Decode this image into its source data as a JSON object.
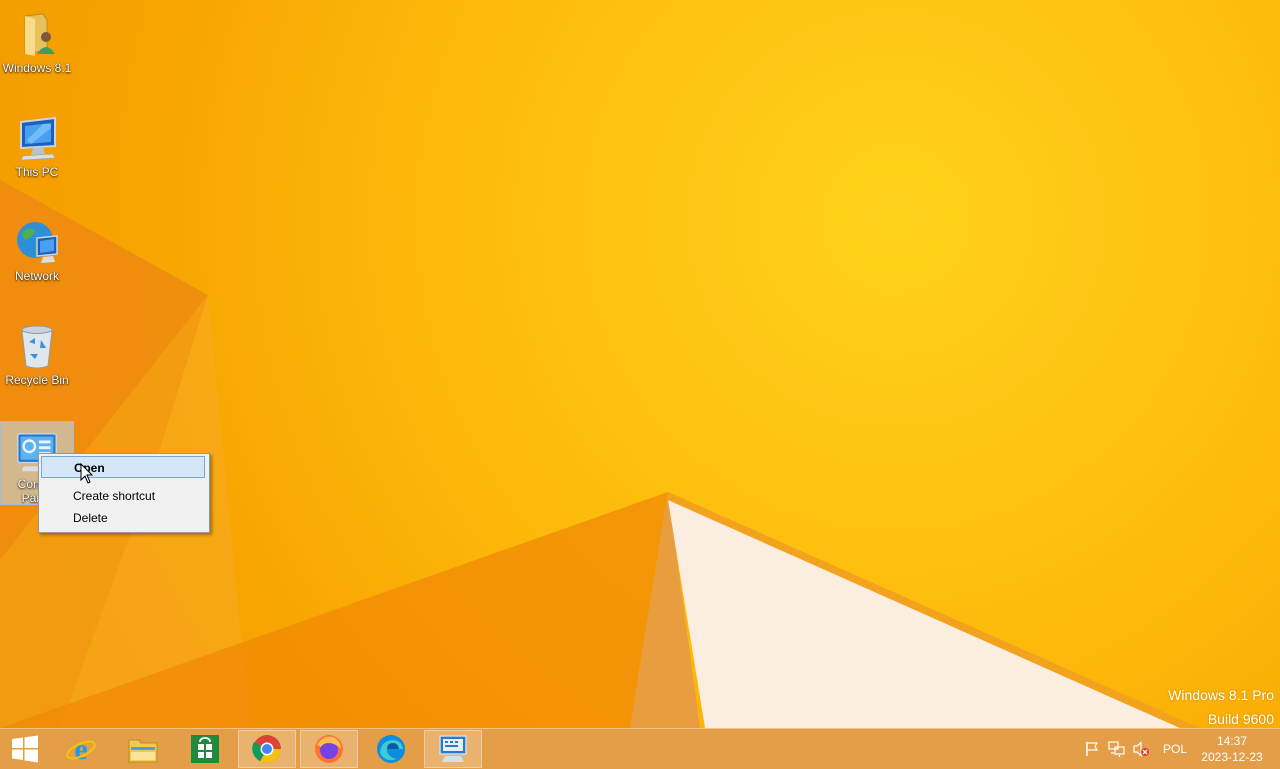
{
  "desktop": {
    "icons": [
      {
        "label": "Windows 8.1",
        "icon": "user-folder-icon"
      },
      {
        "label": "This PC",
        "icon": "computer-icon"
      },
      {
        "label": "Network",
        "icon": "network-globe-icon"
      },
      {
        "label": "Recycle Bin",
        "icon": "recycle-bin-icon"
      },
      {
        "label": "Control Panel",
        "icon": "control-panel-icon",
        "selected": true
      }
    ]
  },
  "context_menu": {
    "items": [
      {
        "label": "Open",
        "bold": true,
        "hovered": true
      },
      {
        "label": "Create shortcut"
      },
      {
        "label": "Delete"
      }
    ]
  },
  "watermark": {
    "edition": "Windows 8.1 Pro",
    "build": "Build 9600"
  },
  "taskbar": {
    "pinned": [
      {
        "icon": "start-windows-icon"
      },
      {
        "icon": "internet-explorer-icon"
      },
      {
        "icon": "file-explorer-icon"
      },
      {
        "icon": "store-icon"
      },
      {
        "icon": "chrome-icon",
        "active": true
      },
      {
        "icon": "firefox-icon",
        "active": true
      },
      {
        "icon": "edge-icon"
      },
      {
        "icon": "on-screen-keyboard-icon",
        "active": true
      }
    ],
    "tray": {
      "icons": [
        "action-center-flag-icon",
        "network-icon",
        "volume-muted-icon"
      ],
      "language": "POL",
      "time": "14:37",
      "date": "2023-12-23"
    }
  },
  "colors": {
    "wallpaper": "#fdb90a",
    "taskbar": "#e1963a",
    "menu_hover": "#d5e6f7"
  }
}
